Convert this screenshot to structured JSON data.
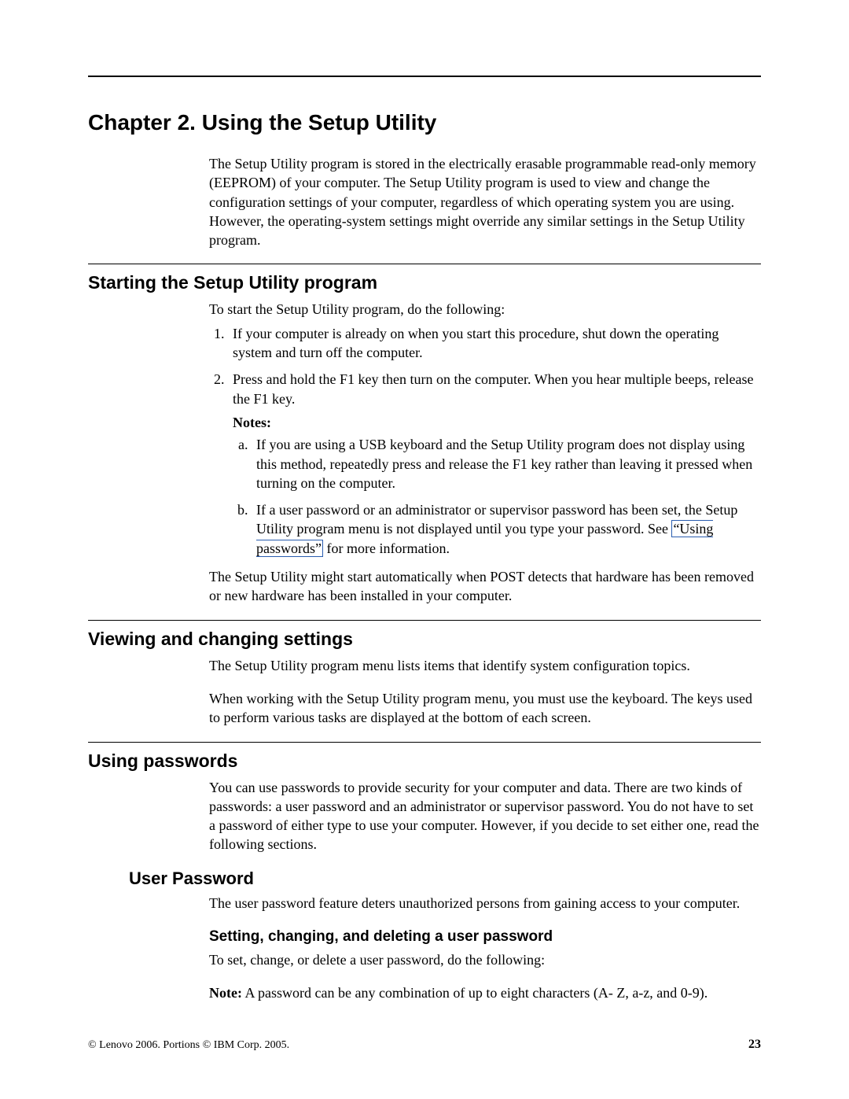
{
  "chapter": {
    "title": "Chapter 2. Using the Setup Utility",
    "intro": "The Setup Utility program is stored in the electrically erasable programmable read-only memory (EEPROM) of your computer. The Setup Utility program is used to view and change the configuration settings of your computer, regardless of which operating system you are using. However, the operating-system settings might override any similar settings in the Setup Utility program."
  },
  "section_start": {
    "heading": "Starting the Setup Utility program",
    "lead": "To start the Setup Utility program, do the following:",
    "steps": [
      "If your computer is already on when you start this procedure, shut down the operating system and turn off the computer.",
      "Press and hold the F1 key then turn on the computer. When you hear multiple beeps, release the F1 key."
    ],
    "notes_label": "Notes:",
    "notes": [
      "If you are using a USB keyboard and the Setup Utility program does not display using this method, repeatedly press and release the F1 key rather than leaving it pressed when turning on the computer.",
      {
        "pre": "If a user password or an administrator or supervisor password has been set, the Setup Utility program menu is not displayed until you type your password. See ",
        "link": "“Using passwords”",
        "post": " for more information."
      }
    ],
    "tail": "The Setup Utility might start automatically when POST detects that hardware has been removed or new hardware has been installed in your computer."
  },
  "section_view": {
    "heading": "Viewing and changing settings",
    "p1": "The Setup Utility program menu lists items that identify system configuration topics.",
    "p2": "When working with the Setup Utility program menu, you must use the keyboard. The keys used to perform various tasks are displayed at the bottom of each screen."
  },
  "section_pw": {
    "heading": "Using passwords",
    "p1": "You can use passwords to provide security for your computer and data. There are two kinds of passwords: a user password and an administrator or supervisor password. You do not have to set a password of either type to use your computer. However, if you decide to set either one, read the following sections.",
    "sub_heading": "User Password",
    "sub_p1": "The user password feature deters unauthorized persons from gaining access to your computer.",
    "sub2_heading": "Setting, changing, and deleting a user password",
    "sub2_p1": "To set, change, or delete a user password, do the following:",
    "note_label": "Note:",
    "note_text": " A password can be any combination of up to eight characters (A- Z, a-z, and 0-9)."
  },
  "footer": {
    "copyright": "© Lenovo 2006. Portions © IBM Corp. 2005.",
    "page": "23"
  }
}
